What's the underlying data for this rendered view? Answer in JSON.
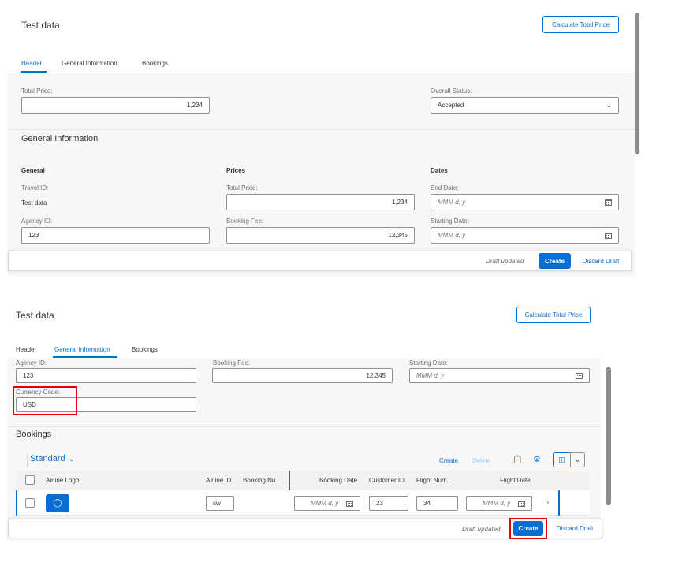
{
  "top": {
    "title": "Test data",
    "calc_button": "Calculate Total Price",
    "tabs": [
      {
        "label": "Header",
        "active": true
      },
      {
        "label": "General Information",
        "active": false
      },
      {
        "label": "Bookings",
        "active": false
      }
    ],
    "header_section": {
      "total_price_label": "Total Price:",
      "total_price_value": "1,234",
      "overall_status_label": "Overall Status:",
      "overall_status_value": "Accepted"
    },
    "general_info": {
      "title": "General Information",
      "general": {
        "title": "General",
        "travel_id_label": "Travel ID:",
        "travel_id_value": "Test data",
        "agency_id_label": "Agency ID:",
        "agency_id_value": "123"
      },
      "prices": {
        "title": "Prices",
        "total_price_label": "Total Price:",
        "total_price_value": "1,234",
        "booking_fee_label": "Booking Fee:",
        "booking_fee_value": "12,345"
      },
      "dates": {
        "title": "Dates",
        "end_date_label": "End Date:",
        "end_date_placeholder": "MMM d, y",
        "starting_date_label": "Starting Date:",
        "starting_date_placeholder": "MMM d, y"
      }
    },
    "footer": {
      "draft_status": "Draft updated",
      "create": "Create",
      "discard": "Discard Draft"
    }
  },
  "bottom": {
    "title": "Test data",
    "calc_button": "Calculate Total Price",
    "tabs": [
      {
        "label": "Header",
        "active": false
      },
      {
        "label": "General Information",
        "active": true
      },
      {
        "label": "Bookings",
        "active": false
      }
    ],
    "fields": {
      "agency_id_label": "Agency ID:",
      "agency_id_value": "123",
      "booking_fee_label": "Booking Fee:",
      "booking_fee_value": "12,345",
      "starting_date_label": "Starting Date:",
      "starting_date_placeholder": "MMM d, y",
      "currency_code_label": "Currency Code:",
      "currency_code_value": "USD"
    },
    "bookings": {
      "title": "Bookings",
      "variant": "Standard",
      "create": "Create",
      "delete": "Delete",
      "columns": [
        "Airline Logo",
        "Airline ID",
        "Booking Nu...",
        "Booking Date",
        "Customer ID",
        "Flight Num...",
        "Flight Date"
      ],
      "row": {
        "airline_id": "sw",
        "booking_date_placeholder": "MMM d, y",
        "customer_id": "23",
        "flight_number": "34",
        "flight_date_placeholder": "MMM d, y"
      }
    },
    "footer": {
      "draft_status": "Draft updated",
      "create": "Create",
      "discard": "Discard Draft"
    }
  },
  "colors": {
    "accent": "#0a6ed1",
    "highlight": "#e00000"
  }
}
